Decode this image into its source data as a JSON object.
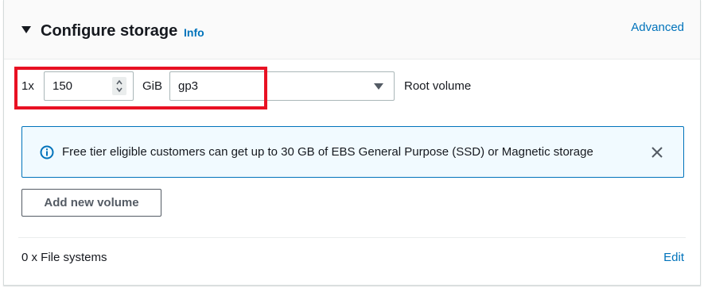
{
  "section": {
    "title": "Configure storage",
    "info_label": "Info",
    "advanced_label": "Advanced"
  },
  "volume_row": {
    "quantity": "1x",
    "size_value": "150",
    "size_unit": "GiB",
    "volume_type": "gp3",
    "volume_label": "Root volume"
  },
  "alert": {
    "message": "Free tier eligible customers can get up to 30 GB of EBS General Purpose (SSD) or Magnetic storage",
    "icon": "info-circle-icon",
    "close_icon": "close-icon"
  },
  "actions": {
    "add_volume_label": "Add new volume"
  },
  "file_systems": {
    "label": "0 x File systems",
    "edit_label": "Edit"
  },
  "colors": {
    "link": "#0073bb",
    "highlight": "#e81123",
    "alert_bg": "#f1faff",
    "alert_border": "#0073bb"
  }
}
